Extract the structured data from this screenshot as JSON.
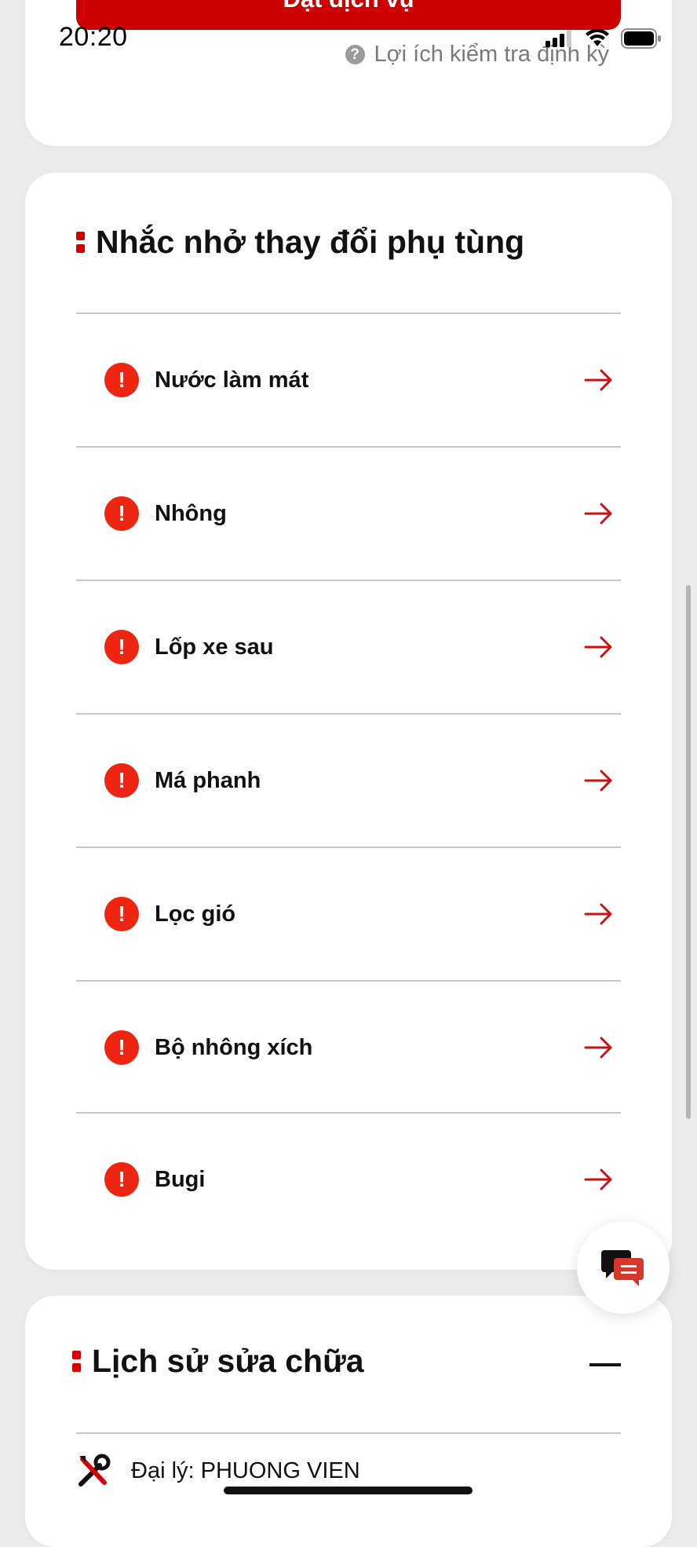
{
  "top_action": {
    "label": "Đặt dịch vụ"
  },
  "status_bar": {
    "time": "20:20"
  },
  "summary_card": {
    "hint_text": "Lợi ích kiểm tra định kỳ"
  },
  "parts_reminder": {
    "title": "Nhắc nhở thay đổi phụ tùng",
    "items": [
      {
        "label": "Nước làm mát",
        "status_icon": "alert-icon",
        "action_icon": "arrow-right-icon"
      },
      {
        "label": "Nhông",
        "status_icon": "alert-icon",
        "action_icon": "arrow-right-icon"
      },
      {
        "label": "Lốp xe sau",
        "status_icon": "alert-icon",
        "action_icon": "arrow-right-icon"
      },
      {
        "label": "Má phanh",
        "status_icon": "alert-icon",
        "action_icon": "arrow-right-icon"
      },
      {
        "label": "Lọc gió",
        "status_icon": "alert-icon",
        "action_icon": "arrow-right-icon"
      },
      {
        "label": "Bộ nhông xích",
        "status_icon": "alert-icon",
        "action_icon": "arrow-right-icon"
      },
      {
        "label": "Bugi",
        "status_icon": "alert-icon",
        "action_icon": "arrow-right-icon"
      }
    ]
  },
  "repair_history": {
    "title": "Lịch sử sửa chữa",
    "dealer_text": "Đại lý: PHUONG VIEN"
  },
  "colors": {
    "accent": "#cc0000",
    "alert": "#ee2511",
    "arrow": "#cc1111"
  }
}
